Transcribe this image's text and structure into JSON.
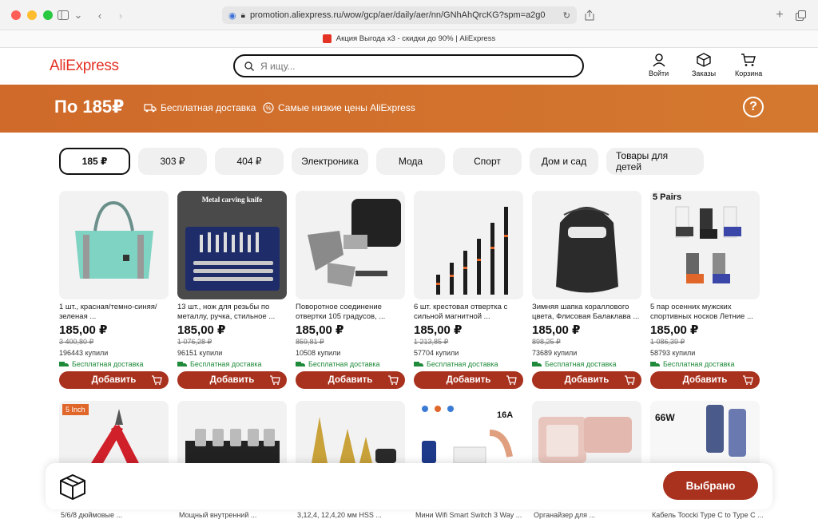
{
  "browser": {
    "url": "promotion.aliexpress.ru/wow/gcp/aer/daily/aer/nn/GNhAhQrcKG?spm=a2g0",
    "tab_title": "Акция Выгода х3 - скидки до 90% | AliExpress"
  },
  "header": {
    "logo": "AliExpress",
    "search_placeholder": "Я ищу...",
    "login": "Войти",
    "orders": "Заказы",
    "cart": "Корзина"
  },
  "banner": {
    "title": "По 185₽",
    "free_delivery": "Бесплатная доставка",
    "lowest_prices": "Самые низкие цены AliExpress"
  },
  "chips": [
    "185 ₽",
    "303 ₽",
    "404 ₽",
    "Электроника",
    "Мода",
    "Спорт",
    "Дом и сад",
    "Товары для детей"
  ],
  "products": [
    {
      "title": "1 шт., красная/темно-синяя/зеленая ...",
      "price": "185,00 ₽",
      "old_price": "3 400,80 ₽",
      "sold": "196443 купили",
      "ship": "Бесплатная доставка",
      "add": "Добавить"
    },
    {
      "title": "13 шт., нож для резьбы по металлу, ручка, стильное ...",
      "price": "185,00 ₽",
      "old_price": "1 076,28 ₽",
      "sold": "96151 купили",
      "ship": "Бесплатная доставка",
      "add": "Добавить",
      "img_label": "Metal carving knife"
    },
    {
      "title": "Поворотное соединение отвертки 105 градусов, ...",
      "price": "185,00 ₽",
      "old_price": "859,81 ₽",
      "sold": "10508 купили",
      "ship": "Бесплатная доставка",
      "add": "Добавить"
    },
    {
      "title": "6 шт. крестовая отвертка с сильной магнитной ...",
      "price": "185,00 ₽",
      "old_price": "1 213,85 ₽",
      "sold": "57704 купили",
      "ship": "Бесплатная доставка",
      "add": "Добавить"
    },
    {
      "title": "Зимняя шапка кораллового цвета, Флисовая Балаклава ...",
      "price": "185,00 ₽",
      "old_price": "898,25 ₽",
      "sold": "73689 купили",
      "ship": "Бесплатная доставка",
      "add": "Добавить"
    },
    {
      "title": "5 пар осенних мужских спортивных носков Летние ...",
      "price": "185,00 ₽",
      "old_price": "1 086,39 ₽",
      "sold": "58793 купили",
      "ship": "Бесплатная доставка",
      "add": "Добавить",
      "img_label": "5 Pairs"
    }
  ],
  "row2_badges": {
    "first": "5 Inch",
    "fourth": "16A",
    "sixth": "66W"
  },
  "row2_peek_titles": [
    "5/6/8 дюймовые ...",
    "Мощный внутренний ...",
    "3,12,4, 12,4,20 мм HSS ...",
    "Мини Wifi Smart Switch 3 Way ...",
    "Органайзер для ...",
    "Кабель Toocki Type C to Type C ..."
  ],
  "floatbar": {
    "chosen": "Выбрано"
  },
  "colors": {
    "brand": "#e43225",
    "banner": "#cf6a2a",
    "button": "#a9321f",
    "ship": "#1f8a3a"
  }
}
